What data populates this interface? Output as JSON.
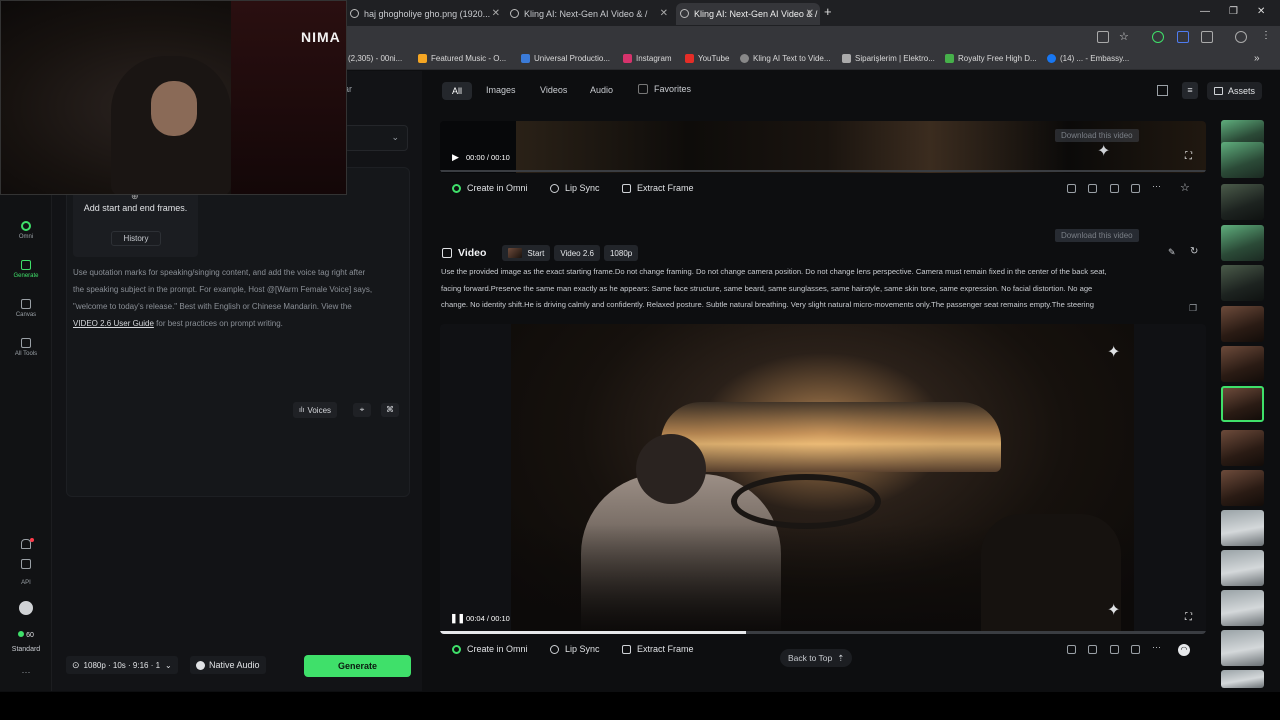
{
  "browser": {
    "tabs": [
      {
        "label": "haj ghogholiye gho.png (1920..."
      },
      {
        "label": "Kling AI: Next-Gen AI Video & /"
      },
      {
        "label": "Kling AI: Next-Gen AI Video & /"
      }
    ],
    "new_tab_label": "+",
    "bookmarks": [
      {
        "label": "(2,305) - 00ni..."
      },
      {
        "label": "Featured Music - O..."
      },
      {
        "label": "Universal Productio..."
      },
      {
        "label": "Instagram"
      },
      {
        "label": "YouTube"
      },
      {
        "label": "Kling AI Text to Vide..."
      },
      {
        "label": "Siparişlerim | Elektro..."
      },
      {
        "label": "Royalty Free High D..."
      },
      {
        "label": "(14) ... - Embassy..."
      }
    ],
    "bookmark_overflow": "»",
    "webcam_overlay_text": "NIMA"
  },
  "rail": {
    "items": [
      {
        "label": "Omni"
      },
      {
        "label": "Generate"
      },
      {
        "label": "Canvas"
      },
      {
        "label": "All Tools"
      }
    ],
    "api_label": "API",
    "credits": "60",
    "plan": "Standard",
    "more": "···"
  },
  "panel": {
    "header_fragment": "ar",
    "frames_title": "Add start and end frames.",
    "history_button": "History",
    "hint_line1": "Use quotation marks for speaking/singing content, and add the voice tag right after",
    "hint_line2": "the speaking subject in the prompt. For example, Host @[Warm Female Voice] says,",
    "hint_line3": "\"welcome to today's release.\" Best with English or Chinese Mandarin. View the",
    "guide_link": "VIDEO 2.6 User Guide",
    "hint_line4": " for best practices on prompt writing.",
    "voices_button": "Voices",
    "settings_summary": "1080p · 10s · 9:16 · 1",
    "native_audio": "Native Audio",
    "generate_button": "Generate"
  },
  "toolbar": {
    "filters": [
      {
        "label": "All"
      },
      {
        "label": "Images"
      },
      {
        "label": "Videos"
      },
      {
        "label": "Audio"
      }
    ],
    "favorites": "Favorites",
    "assets": "Assets"
  },
  "card1": {
    "time": "00:00 / 00:10",
    "download_badge": "Download this video",
    "actions": {
      "omni": "Create in Omni",
      "lipsync": "Lip Sync",
      "extract": "Extract Frame"
    }
  },
  "card2": {
    "section_label": "Video",
    "tags": {
      "start": "Start",
      "model": "Video 2.6",
      "resolution": "1080p"
    },
    "download_badge": "Download this video",
    "prompt_line1": "Use the provided image as the exact starting frame.Do not change framing. Do not change camera position. Do not change lens perspective. Camera must remain fixed in the center of the back seat,",
    "prompt_line2": "facing forward.Preserve the same man exactly as he appears: Same face structure, same beard, same sunglasses, same hairstyle, same skin tone, same expression. No facial distortion. No age",
    "prompt_line3": "change. No identity shift.He is driving calmly and confidently. Relaxed posture. Subtle natural breathing. Very slight natural micro-movements only.The passenger seat remains empty.The steering",
    "time": "00:04 / 00:10",
    "progress": 0.4,
    "actions": {
      "omni": "Create in Omni",
      "lipsync": "Lip Sync",
      "extract": "Extract Frame"
    },
    "back_to_top": "Back to Top"
  },
  "colors": {
    "accent": "#3fe06a",
    "background": "#0d0e10",
    "panel": "#121316"
  }
}
